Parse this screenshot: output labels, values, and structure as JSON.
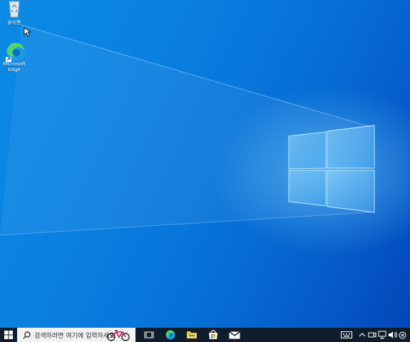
{
  "desktop": {
    "icons": [
      {
        "label": "휴지통",
        "icon": "recycle-bin-icon"
      },
      {
        "label": "Microsoft Edge",
        "icon": "edge-icon"
      }
    ]
  },
  "taskbar": {
    "search_placeholder": "검색하려면 여기에 입력하세요",
    "pinned": [
      "task-view-icon",
      "edge-icon",
      "file-explorer-icon",
      "store-icon",
      "mail-icon"
    ],
    "tray": [
      "keyboard-icon",
      "chevron-up-icon",
      "meet-icon",
      "network-icon",
      "volume-icon",
      "notification-icon"
    ]
  },
  "colors": {
    "desktop_blue": "#0a7fe0",
    "taskbar": "#0f1c2b",
    "search_box": "#f2f2f2"
  }
}
